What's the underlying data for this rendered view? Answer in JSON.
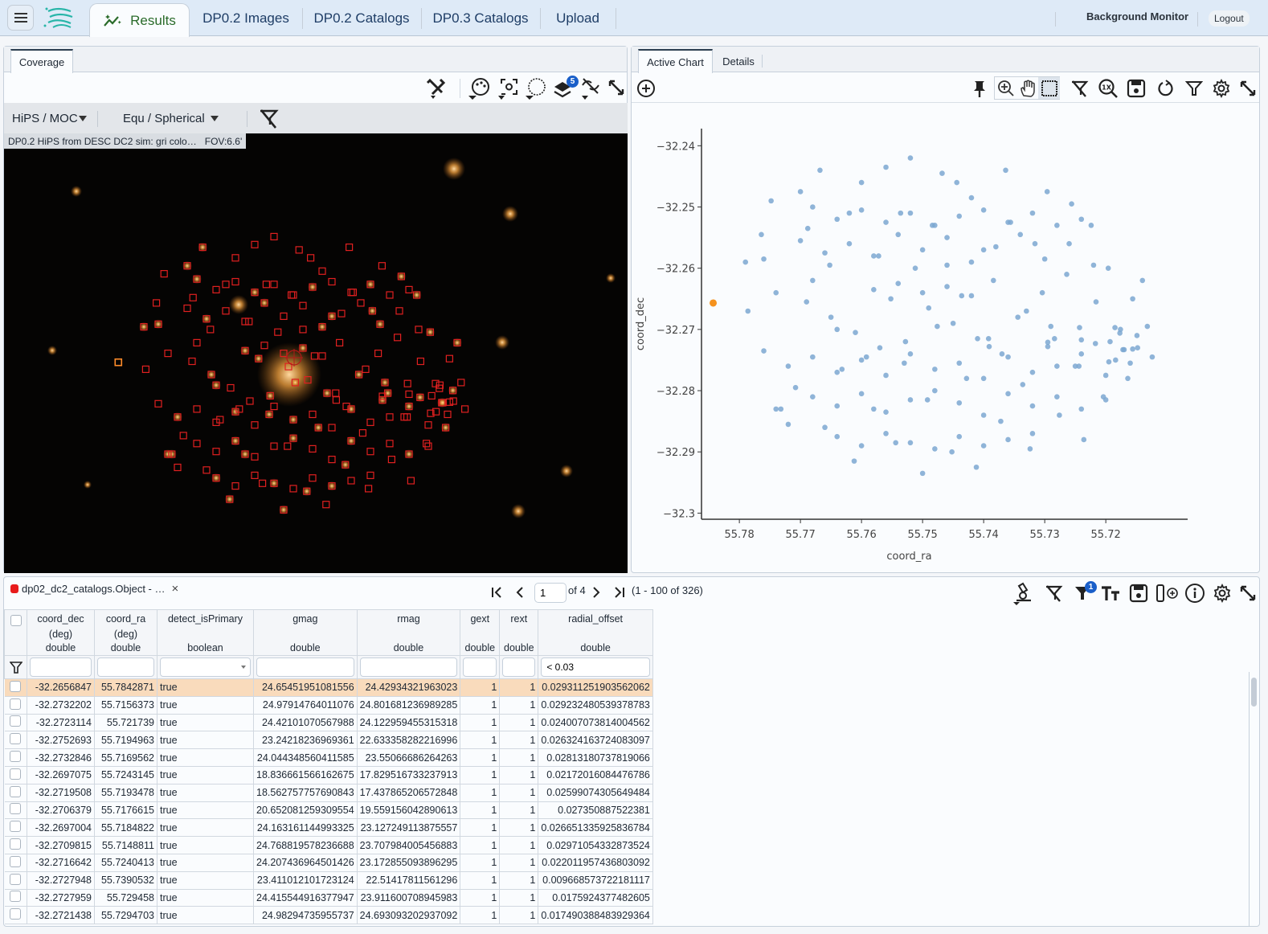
{
  "topbar": {
    "tabs": [
      {
        "label": "Results",
        "icon": "chart-sparkle-icon",
        "active": true
      },
      {
        "label": "DP0.2 Images"
      },
      {
        "label": "DP0.2 Catalogs"
      },
      {
        "label": "DP0.3 Catalogs"
      },
      {
        "label": "Upload"
      }
    ],
    "background_monitor": "Background Monitor",
    "logout": "Logout"
  },
  "image_panel": {
    "tab": "Coverage",
    "toolbar_icons": [
      "tools-icon",
      "color-palette-icon",
      "recenter-icon",
      "selection-lasso-icon",
      "layers-icon",
      "lock-unlink-icon",
      "expand-icon"
    ],
    "layers_badge": "5",
    "projection_dropdown": "HiPS / MOC",
    "coords_dropdown": "Equ / Spherical",
    "caption": "DP0.2 HiPS from DESC DC2 sim: gri colo…",
    "fov": "FOV:6.6'",
    "overlay_color": "#e02020"
  },
  "chart_panel": {
    "tabs": [
      "Active Chart",
      "Details"
    ],
    "toolbar_icons": [
      "pin-icon",
      "zoom-in-icon",
      "pan-hand-icon",
      "select-rect-icon",
      "clear-filter-icon",
      "zoom-1x-icon",
      "save-icon",
      "reset-icon",
      "filter-icon",
      "settings-gear-icon",
      "expand-icon"
    ]
  },
  "chart_data": {
    "type": "scatter",
    "title": "",
    "xlabel": "coord_ra",
    "ylabel": "coord_dec",
    "xlim": [
      55.7862,
      55.7066
    ],
    "ylim": [
      -32.301,
      -32.2372
    ],
    "x_reversed": true,
    "xticks": [
      55.78,
      55.77,
      55.76,
      55.75,
      55.74,
      55.73,
      55.72
    ],
    "xtick_labels": [
      "55.78",
      "55.77",
      "55.76",
      "55.75",
      "55.74",
      "55.73",
      "55.72"
    ],
    "yticks": [
      -32.24,
      -32.25,
      -32.26,
      -32.27,
      -32.28,
      -32.29,
      -32.3
    ],
    "ytick_labels": [
      "−32.24",
      "−32.25",
      "−32.26",
      "−32.27",
      "−32.28",
      "−32.29",
      "−32.3"
    ],
    "grid": false,
    "point_color": "#7ba7d1",
    "highlight_color": "#f5921e",
    "highlighted": {
      "x": 55.7842871,
      "y": -32.2656847
    },
    "series": [
      {
        "name": "dp02_dc2_catalogs.Object",
        "x": [
          55.779,
          55.7786,
          55.7764,
          55.776,
          55.7748,
          55.774,
          55.7732,
          55.772,
          55.7708,
          55.77,
          55.7688,
          55.768,
          55.7668,
          55.766,
          55.7652,
          55.764,
          55.7632,
          55.762,
          55.7612,
          55.76,
          55.7592,
          55.758,
          55.7572,
          55.756,
          55.7552,
          55.7544,
          55.7536,
          55.7528,
          55.752,
          55.7512,
          55.75,
          55.7492,
          55.7484,
          55.7476,
          55.7468,
          55.746,
          55.7452,
          55.7444,
          55.7436,
          55.7428,
          55.742,
          55.7412,
          55.74,
          55.7392,
          55.7384,
          55.7372,
          55.7364,
          55.7356,
          55.7344,
          55.7336,
          55.7324,
          55.7316,
          55.7304,
          55.7296,
          55.7284,
          55.7276,
          55.7264,
          55.7256,
          55.7244,
          55.7236,
          55.7224,
          55.7216,
          55.7204,
          55.7196,
          55.7184,
          55.7176,
          55.7164,
          55.7156,
          55.7148,
          55.714,
          55.7132,
          55.7124,
          55.7172,
          55.7193,
          55.7243,
          55.7217,
          55.7156,
          55.7195,
          55.717,
          55.7177,
          55.7185,
          55.7149,
          55.724,
          55.7391,
          55.7295,
          55.7295,
          55.769,
          55.765,
          55.761,
          55.757,
          55.753,
          55.749,
          55.745,
          55.741,
          55.737,
          55.733,
          55.729,
          55.725,
          55.77,
          55.766,
          55.762,
          55.758,
          55.754,
          55.75,
          55.746,
          55.742,
          55.738,
          55.734,
          55.73,
          55.726,
          55.722,
          55.774,
          55.768,
          55.764,
          55.76,
          55.756,
          55.752,
          55.748,
          55.744,
          55.74,
          55.736,
          55.732,
          55.728,
          55.724,
          55.72,
          55.776,
          55.772,
          55.768,
          55.764,
          55.76,
          55.756,
          55.752,
          55.748,
          55.744,
          55.74,
          55.736,
          55.732,
          55.728,
          55.724,
          55.72,
          55.716,
          55.768,
          55.764,
          55.76,
          55.756,
          55.752,
          55.748,
          55.744,
          55.74,
          55.736,
          55.732,
          55.728,
          55.724,
          55.764,
          55.76,
          55.756,
          55.752,
          55.748,
          55.744,
          55.74,
          55.736,
          55.732,
          55.758,
          55.754,
          55.75,
          55.746,
          55.742
        ],
        "y": [
          -32.259,
          -32.267,
          -32.2545,
          -32.2585,
          -32.249,
          -32.264,
          -32.283,
          -32.2855,
          -32.2795,
          -32.2475,
          -32.2535,
          -32.262,
          -32.244,
          -32.286,
          -32.2595,
          -32.27,
          -32.2765,
          -32.251,
          -32.2915,
          -32.246,
          -32.2745,
          -32.283,
          -32.258,
          -32.2435,
          -32.265,
          -32.2885,
          -32.251,
          -32.272,
          -32.242,
          -32.26,
          -32.2935,
          -32.2815,
          -32.253,
          -32.2695,
          -32.2445,
          -32.2595,
          -32.29,
          -32.246,
          -32.2645,
          -32.278,
          -32.2485,
          -32.2925,
          -32.257,
          -32.2715,
          -32.262,
          -32.285,
          -32.244,
          -32.2525,
          -32.268,
          -32.279,
          -32.2895,
          -32.256,
          -32.264,
          -32.2475,
          -32.2715,
          -32.284,
          -32.261,
          -32.2495,
          -32.276,
          -32.288,
          -32.253,
          -32.2655,
          -32.281,
          -32.26,
          -32.275,
          -32.27,
          -32.278,
          -32.265,
          -32.273,
          -32.262,
          -32.2695,
          -32.2745,
          -32.2733,
          -32.272,
          -32.2697,
          -32.2723,
          -32.2732,
          -32.2753,
          -32.2733,
          -32.2706,
          -32.2697,
          -32.271,
          -32.2717,
          -32.2728,
          -32.2728,
          -32.2721,
          -32.2655,
          -32.268,
          -32.2705,
          -32.273,
          -32.2755,
          -32.2665,
          -32.269,
          -32.2715,
          -32.274,
          -32.267,
          -32.2695,
          -32.276,
          -32.2555,
          -32.2575,
          -32.256,
          -32.258,
          -32.2545,
          -32.257,
          -32.255,
          -32.259,
          -32.2565,
          -32.2545,
          -32.2585,
          -32.256,
          -32.2595,
          -32.283,
          -32.281,
          -32.2825,
          -32.2805,
          -32.2835,
          -32.2815,
          -32.28,
          -32.282,
          -32.284,
          -32.2805,
          -32.2825,
          -32.281,
          -32.283,
          -32.2815,
          -32.2735,
          -32.276,
          -32.2745,
          -32.277,
          -32.275,
          -32.2775,
          -32.274,
          -32.2765,
          -32.2755,
          -32.278,
          -32.2745,
          -32.277,
          -32.276,
          -32.274,
          -32.2775,
          -32.2755,
          -32.25,
          -32.252,
          -32.2505,
          -32.2525,
          -32.251,
          -32.253,
          -32.2515,
          -32.2505,
          -32.2525,
          -32.251,
          -32.253,
          -32.252,
          -32.2875,
          -32.289,
          -32.287,
          -32.2885,
          -32.2895,
          -32.2875,
          -32.289,
          -32.288,
          -32.287,
          -32.2635,
          -32.2625,
          -32.264,
          -32.263,
          -32.2645
        ]
      }
    ]
  },
  "table_panel": {
    "title": "dp02_dc2_catalogs.Object - …",
    "close_icon": "×",
    "pager": {
      "current_page": "1",
      "of_label": "of 4",
      "range": "(1 - 100 of 326)"
    },
    "toolbar_icons": [
      "statistics-microscope-icon",
      "clear-filter-icon",
      "filter-icon",
      "text-view-icon",
      "save-icon",
      "add-column-icon",
      "info-icon",
      "settings-gear-icon",
      "expand-icon"
    ],
    "filter_badge": "1",
    "columns": [
      {
        "name": "coord_dec",
        "unit": "(deg)",
        "type": "double",
        "filter": ""
      },
      {
        "name": "coord_ra",
        "unit": "(deg)",
        "type": "double",
        "filter": ""
      },
      {
        "name": "detect_isPrimary",
        "unit": "",
        "type": "boolean",
        "filter": ""
      },
      {
        "name": "gmag",
        "unit": "",
        "type": "double",
        "filter": ""
      },
      {
        "name": "rmag",
        "unit": "",
        "type": "double",
        "filter": ""
      },
      {
        "name": "gext",
        "unit": "",
        "type": "double",
        "filter": ""
      },
      {
        "name": "rext",
        "unit": "",
        "type": "double",
        "filter": ""
      },
      {
        "name": "radial_offset",
        "unit": "",
        "type": "double",
        "filter": "< 0.03"
      }
    ],
    "rows": [
      [
        "-32.2656847",
        "55.7842871",
        "true",
        "24.65451951081556",
        "24.42934321963023",
        "1",
        "1",
        "0.029311251903562062"
      ],
      [
        "-32.2732202",
        "55.7156373",
        "true",
        "24.97914764011076",
        "24.801681236989285",
        "1",
        "1",
        "0.029232480539378783"
      ],
      [
        "-32.2723114",
        "55.721739",
        "true",
        "24.42101070567988",
        "24.122959455315318",
        "1",
        "1",
        "0.024007073814004562"
      ],
      [
        "-32.2752693",
        "55.7194963",
        "true",
        "23.24218236969361",
        "22.633358282216996",
        "1",
        "1",
        "0.026324163724083097"
      ],
      [
        "-32.2732846",
        "55.7169562",
        "true",
        "24.044348560411585",
        "23.55066686264263",
        "1",
        "1",
        "0.02813180737819066"
      ],
      [
        "-32.2697075",
        "55.7243145",
        "true",
        "18.836661566162675",
        "17.829516733237913",
        "1",
        "1",
        "0.02172016084476786"
      ],
      [
        "-32.2719508",
        "55.7193478",
        "true",
        "18.562757757690843",
        "17.437865206572848",
        "1",
        "1",
        "0.02599074305649484"
      ],
      [
        "-32.2706379",
        "55.7176615",
        "true",
        "20.652081259309554",
        "19.559156042890613",
        "1",
        "1",
        "0.027350887522381"
      ],
      [
        "-32.2697004",
        "55.7184822",
        "true",
        "24.163161144993325",
        "23.127249113875557",
        "1",
        "1",
        "0.026651335925836784"
      ],
      [
        "-32.2709815",
        "55.7148811",
        "true",
        "24.768819578236688",
        "23.707984005456883",
        "1",
        "1",
        "0.02971054332873524"
      ],
      [
        "-32.2716642",
        "55.7240413",
        "true",
        "24.207436964501426",
        "23.172855093896295",
        "1",
        "1",
        "0.022011957436803092"
      ],
      [
        "-32.2727948",
        "55.7390532",
        "true",
        "23.411012101723124",
        "22.51417811561296",
        "1",
        "1",
        "0.009668573722181117"
      ],
      [
        "-32.2727959",
        "55.729458",
        "true",
        "24.415544916377947",
        "23.911600708945983",
        "1",
        "1",
        "0.0175924377482605"
      ],
      [
        "-32.2721438",
        "55.7294703",
        "true",
        "24.98294735955737",
        "24.693093202937092",
        "1",
        "1",
        "0.017490388483929364"
      ]
    ],
    "selected_row": 0
  }
}
